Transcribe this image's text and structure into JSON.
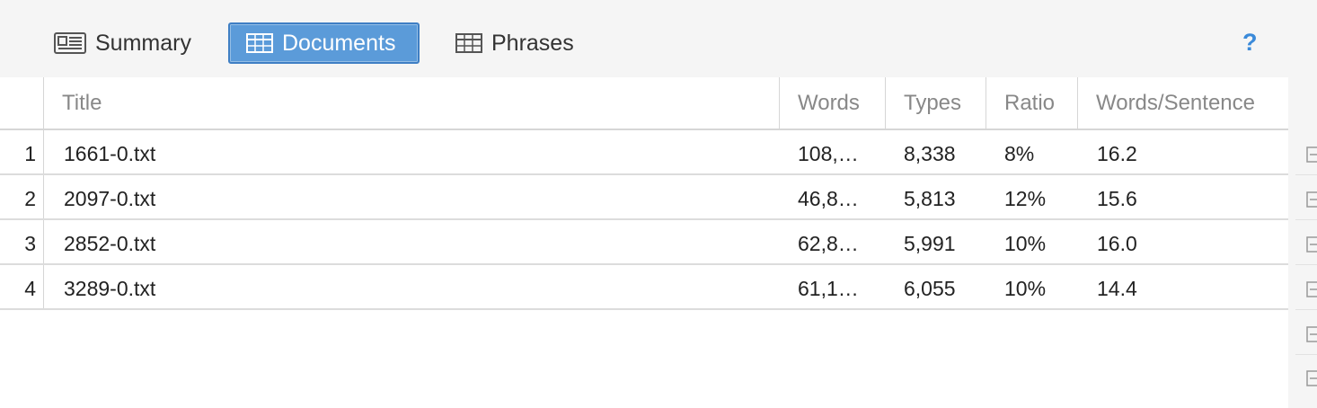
{
  "toolbar": {
    "tabs": [
      {
        "label": "Summary",
        "icon": "newspaper-icon",
        "active": false
      },
      {
        "label": "Documents",
        "icon": "table-grid-icon",
        "active": true
      },
      {
        "label": "Phrases",
        "icon": "table-grid-icon",
        "active": false
      }
    ],
    "help_label": "?"
  },
  "table": {
    "columns": [
      "Title",
      "Words",
      "Types",
      "Ratio",
      "Words/Sentence"
    ],
    "rows": [
      {
        "num": "1",
        "title": "1661-0.txt",
        "words": "108,…",
        "types": "8,338",
        "ratio": "8%",
        "wps": "16.2"
      },
      {
        "num": "2",
        "title": "2097-0.txt",
        "words": "46,8…",
        "types": "5,813",
        "ratio": "12%",
        "wps": "15.6"
      },
      {
        "num": "3",
        "title": "2852-0.txt",
        "words": "62,8…",
        "types": "5,991",
        "ratio": "10%",
        "wps": "16.0"
      },
      {
        "num": "4",
        "title": "3289-0.txt",
        "words": "61,1…",
        "types": "6,055",
        "ratio": "10%",
        "wps": "14.4"
      }
    ]
  },
  "colors": {
    "active_tab": "#5b9bd9",
    "help": "#3b8ad9",
    "toolbar_bg": "#f5f5f5"
  }
}
